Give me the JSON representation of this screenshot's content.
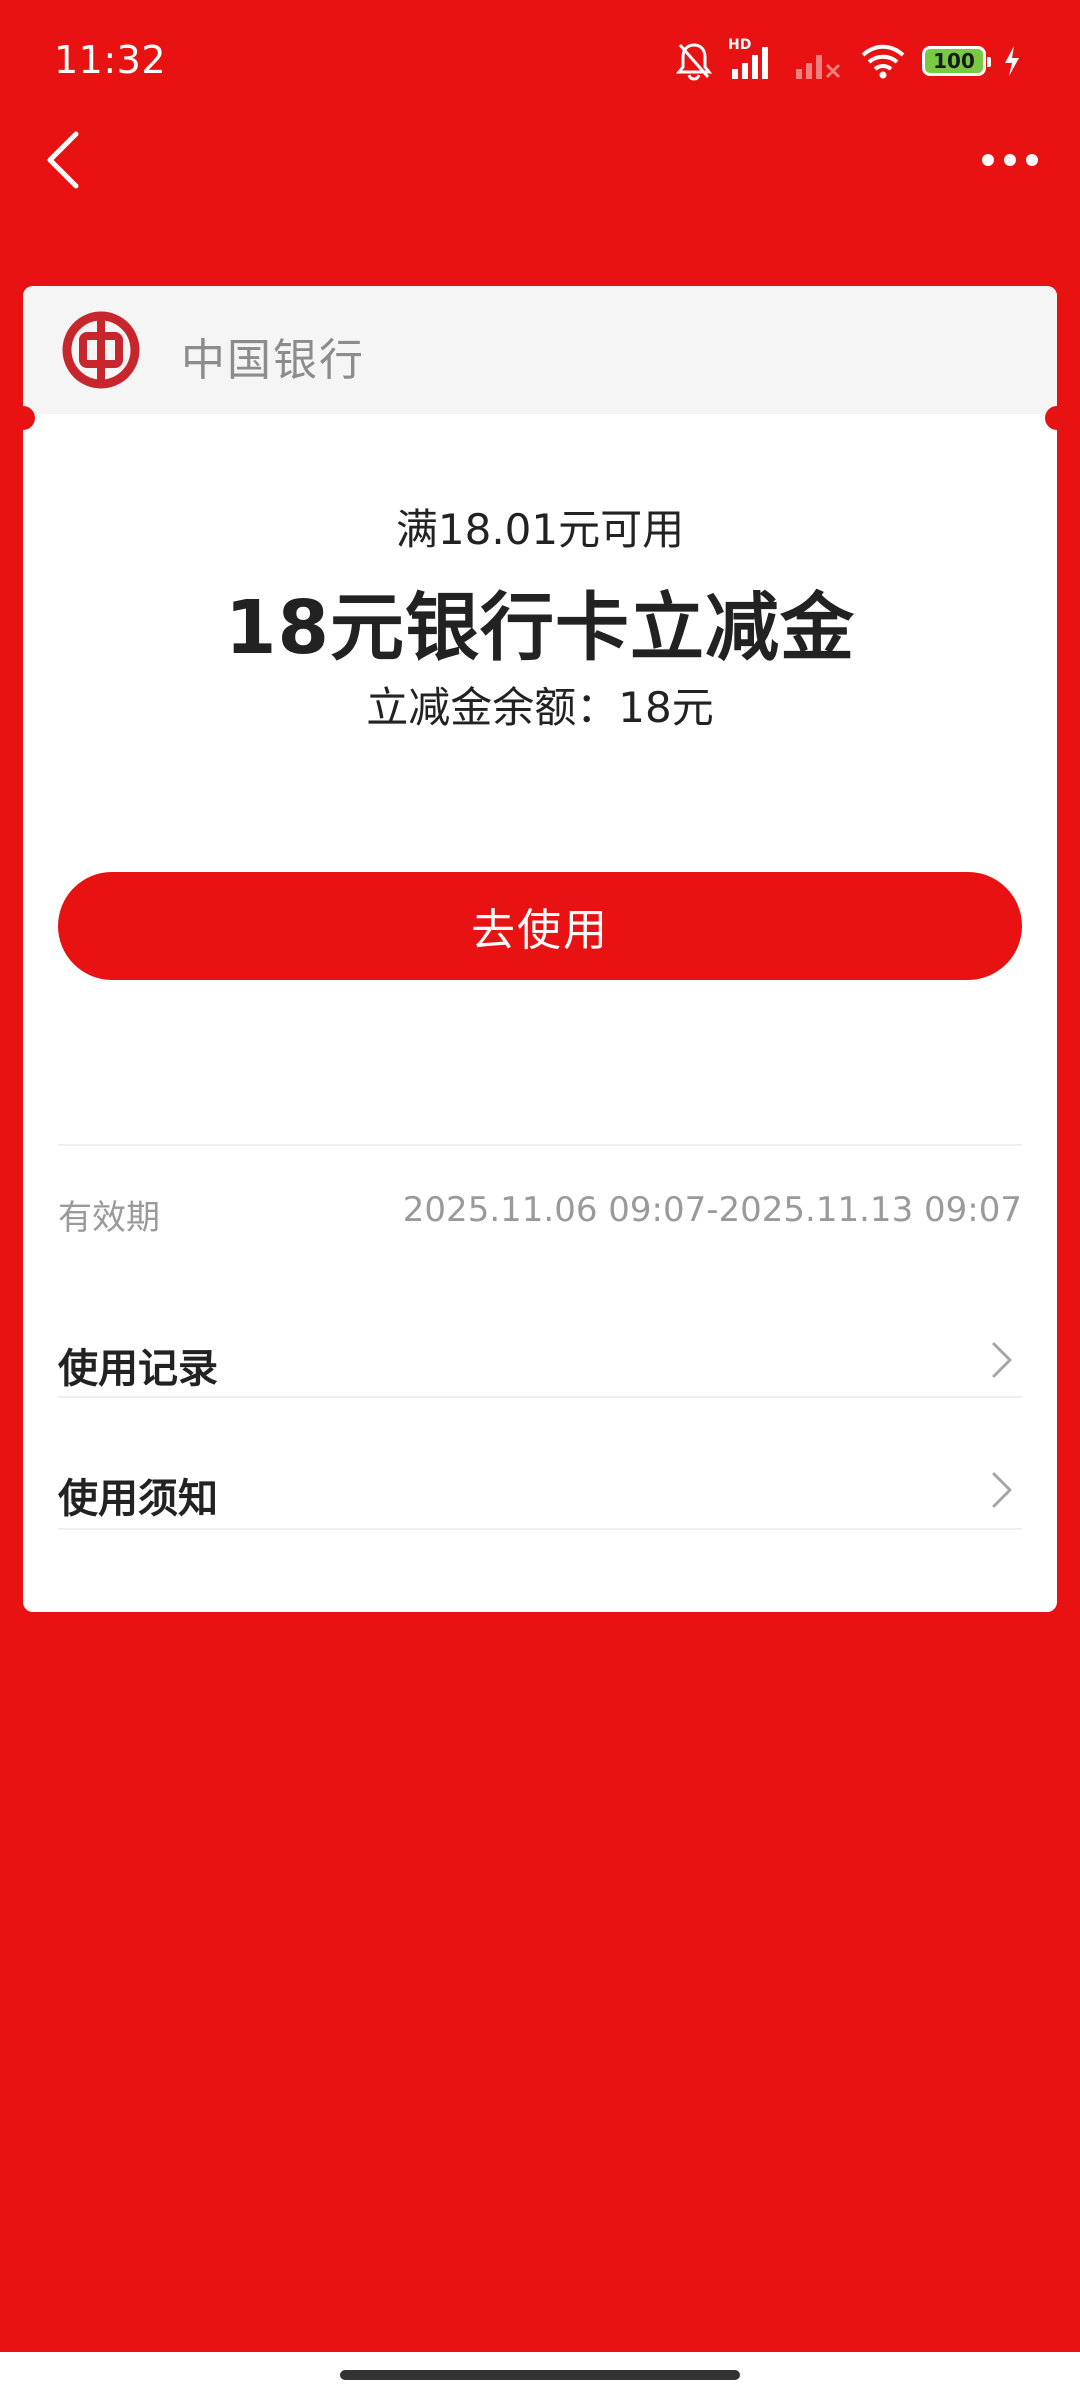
{
  "status_bar": {
    "time": "11:32",
    "network_label": "HD",
    "battery_level": "100",
    "icons": [
      "bell-off-icon",
      "signal-icon",
      "signal-no-service-icon",
      "wifi-icon",
      "battery-icon",
      "charging-icon"
    ]
  },
  "nav": {
    "back_icon": "chevron-left-icon",
    "more_icon": "more-horizontal-icon"
  },
  "card": {
    "bank_name": "中国银行",
    "bank_logo_icon": "bank-of-china-logo-icon",
    "condition": "满18.01元可用",
    "title": "18元银行卡立减金",
    "balance": "立减金余额：18元",
    "use_button_label": "去使用",
    "validity_label": "有效期",
    "validity_value": "2025.11.06 09:07-2025.11.13 09:07",
    "rows": [
      {
        "label": "使用记录",
        "icon": "chevron-right-icon"
      },
      {
        "label": "使用须知",
        "icon": "chevron-right-icon"
      }
    ]
  },
  "colors": {
    "brand_red": "#E81212",
    "card_bg": "#FFFFFF",
    "header_bg": "#F5F5F5",
    "text_primary": "#222222",
    "text_secondary": "#9A9A9A",
    "logo_red": "#C8262D"
  }
}
